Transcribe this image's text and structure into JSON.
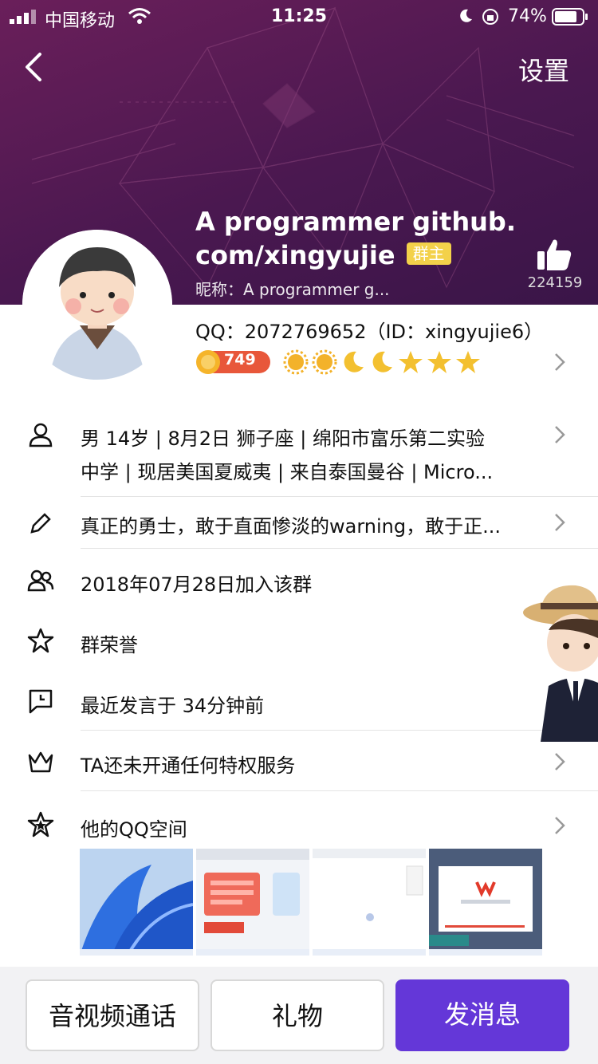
{
  "status_bar": {
    "carrier": "中国移动",
    "time": "11:25",
    "battery": "74%"
  },
  "header": {
    "settings_label": "设置",
    "name": "A programmer github.com/xingyujie",
    "owner_badge": "群主",
    "nickname": "昵称：A programmer g...",
    "like_count": "224159",
    "icons": [
      "back-arrow-icon",
      "thumbs-up-icon"
    ]
  },
  "profile": {
    "qq_line": "QQ：2072769652（ID：xingyujie6）",
    "coin_value": "749",
    "level_icons": [
      "sun",
      "sun",
      "moon",
      "moon",
      "star",
      "star",
      "star"
    ]
  },
  "rows": {
    "basic_info_line1": "男 14岁 | 8月2日 狮子座 | 绵阳市富乐第二实验",
    "basic_info_line2": "中学 | 现居美国夏威夷 | 来自泰国曼谷 | Micro...",
    "signature": "真正的勇士，敢于直面惨淡的warning，敢于正...",
    "joined": "2018年07月28日加入该群",
    "honor": "群荣誉",
    "last_spoke": "最近发言于 34分钟前",
    "privilege": "TA还未开通任何特权服务",
    "qzone": "他的QQ空间"
  },
  "bottom": {
    "call_label": "音视频通话",
    "gift_label": "礼物",
    "message_label": "发消息"
  },
  "colors": {
    "header": "#4a1850",
    "primary": "#6437d8",
    "badge": "#f3d14a"
  }
}
